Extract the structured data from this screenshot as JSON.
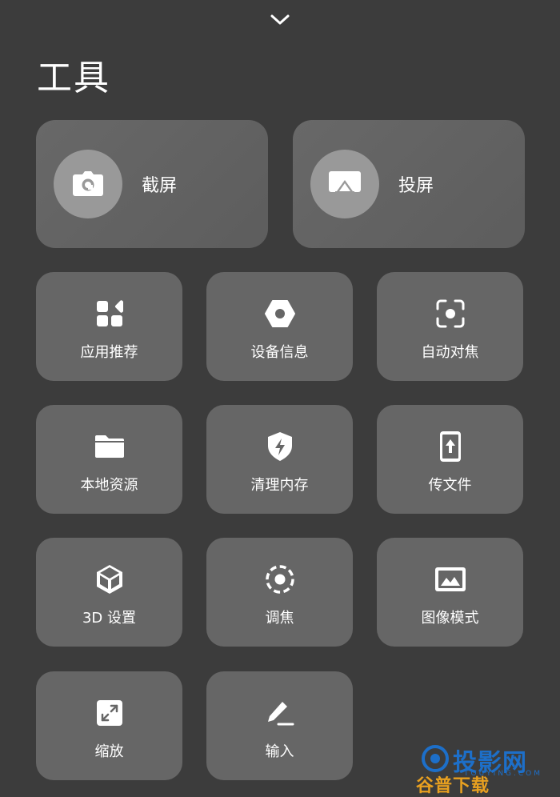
{
  "header": {
    "title": "工具",
    "collapse_icon": "chevron-down-icon"
  },
  "big_tiles": [
    {
      "label": "截屏",
      "icon": "camera-icon"
    },
    {
      "label": "投屏",
      "icon": "screen-cast-icon"
    }
  ],
  "tiles": [
    {
      "label": "应用推荐",
      "icon": "apps-grid-icon"
    },
    {
      "label": "设备信息",
      "icon": "hex-nut-icon"
    },
    {
      "label": "自动对焦",
      "icon": "autofocus-icon"
    },
    {
      "label": "本地资源",
      "icon": "folder-icon"
    },
    {
      "label": "清理内存",
      "icon": "shield-bolt-icon"
    },
    {
      "label": "传文件",
      "icon": "phone-upload-icon"
    },
    {
      "label": "3D 设置",
      "icon": "cube-icon"
    },
    {
      "label": "调焦",
      "icon": "focus-ring-icon"
    },
    {
      "label": "图像模式",
      "icon": "image-mode-icon"
    },
    {
      "label": "缩放",
      "icon": "expand-icon"
    },
    {
      "label": "输入",
      "icon": "pencil-icon"
    }
  ],
  "watermark": {
    "brand": "投影网",
    "sub": "TOUYING.COM",
    "bottom": "谷普下载"
  },
  "colors": {
    "background": "#3c3c3c",
    "tile": "#666666",
    "icon_circle": "#999999",
    "watermark_blue": "#1d6fc9",
    "watermark_orange": "#e8a020"
  }
}
